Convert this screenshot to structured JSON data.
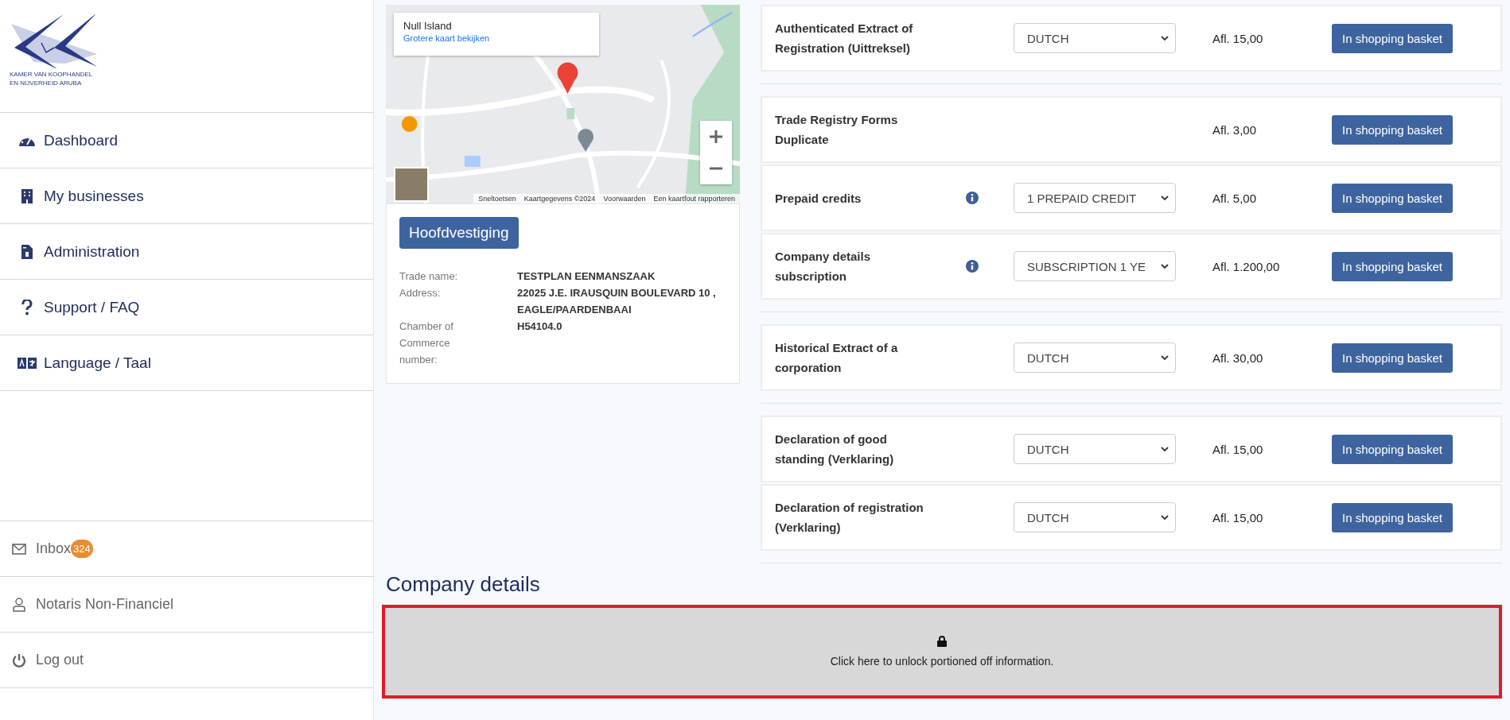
{
  "logo": {
    "line1": "KAMER VAN KOOPHANDEL",
    "line2": "EN NIJVERHEID ARUBA"
  },
  "nav": [
    {
      "kind": "dashboard",
      "label": "Dashboard"
    },
    {
      "kind": "building",
      "label": "My businesses"
    },
    {
      "kind": "invoice",
      "label": "Administration"
    },
    {
      "kind": "question",
      "label": "Support / FAQ"
    },
    {
      "kind": "language",
      "label": "Language / Taal"
    }
  ],
  "account": [
    {
      "kind": "mail",
      "label": "Inbox",
      "badge": "324"
    },
    {
      "kind": "user",
      "label": "Notaris Non-Financiel"
    },
    {
      "kind": "power",
      "label": "Log out"
    }
  ],
  "map": {
    "place": "Null Island",
    "link": "Grotere kaart bekijken",
    "footer": [
      "Sneltoetsen",
      "Kaartgegevens ©2024",
      "Voorwaarden",
      "Een kaartfout rapporteren"
    ]
  },
  "branch": {
    "button": "Hoofdvestiging",
    "fields": [
      {
        "label": "Trade name:",
        "value": "TESTPLAN EENMANSZAAK"
      },
      {
        "label": "Address:",
        "value": "22025 J.E. IRAUSQUIN BOULEVARD 10 , EAGLE/PAARDENBAAI"
      },
      {
        "label": "Chamber of Commerce number:",
        "value": "H54104.0"
      }
    ]
  },
  "product_groups": [
    {
      "products": [
        {
          "name": "Authenticated Extract of Registration (Uittreksel)",
          "info": false,
          "option": "DUTCH",
          "price": "Afl. 15,00",
          "button": "In shopping basket"
        }
      ]
    },
    {
      "products": [
        {
          "name": "Trade Registry Forms Duplicate",
          "info": false,
          "price": "Afl. 3,00",
          "button": "In shopping basket"
        },
        {
          "name": "Prepaid credits",
          "info": true,
          "option": "1 PREPAID CREDIT",
          "price": "Afl. 5,00",
          "button": "In shopping basket"
        },
        {
          "name": "Company details subscription",
          "info": true,
          "option": "SUBSCRIPTION 1 YE",
          "price": "Afl. 1.200,00",
          "button": "In shopping basket"
        }
      ]
    },
    {
      "products": [
        {
          "name": "Historical Extract of a corporation",
          "info": false,
          "option": "DUTCH",
          "price": "Afl. 30,00",
          "button": "In shopping basket"
        }
      ]
    },
    {
      "products": [
        {
          "name": "Declaration of good standing (Verklaring)",
          "info": false,
          "option": "DUTCH",
          "price": "Afl. 15,00",
          "button": "In shopping basket"
        },
        {
          "name": "Declaration of registration (Verklaring)",
          "info": false,
          "option": "DUTCH",
          "price": "Afl. 15,00",
          "button": "In shopping basket"
        }
      ]
    }
  ],
  "company_details": {
    "title": "Company details",
    "unlock": "Click here to unlock portioned off information."
  }
}
